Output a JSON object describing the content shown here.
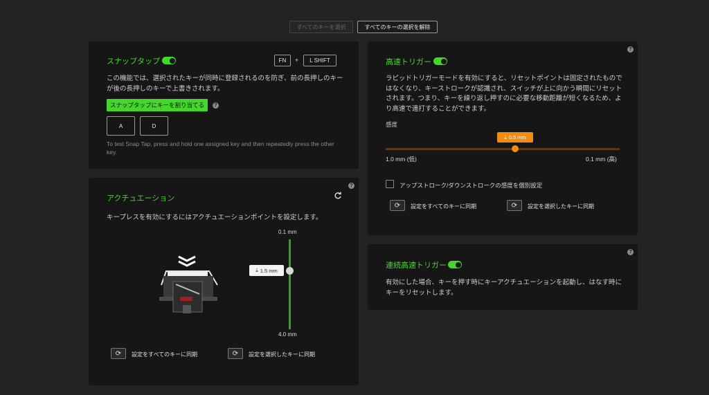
{
  "top": {
    "select_all": "すべてのキーを選択",
    "deselect_all": "すべてのキーの選択を解除"
  },
  "snap_tap": {
    "title": "スナップタップ",
    "key_fn": "FN",
    "plus": "+",
    "key_shift": "L SHIFT",
    "description": "この機能では、選択されたキーが同時に登録されるのを防ぎ、前の長押しのキーが後の長押しのキーで上書きされます。",
    "assign_button": "スナップタップにキーを割り当てる",
    "key_a": "A",
    "key_d": "D",
    "hint": "To test Snap Tap, press and hold one assigned key and then repeatedly press the other key."
  },
  "actuation": {
    "title": "アクチュエーション",
    "description": "キープレスを有効にするにはアクチュエーションポイントを設定します。",
    "top_label": "0.1 mm",
    "bottom_label": "4.0 mm",
    "value_label": "1.5 mm",
    "value": 1.5,
    "sync_all": "設定をすべてのキーに同期",
    "sync_selected": "設定を選択したキーに同期"
  },
  "rapid_trigger": {
    "title": "高速トリガー",
    "description": "ラピッドトリガーモードを有効にすると、リセットポイントは固定されたものではなくなり、キーストロークが認識され、スイッチが上に向かう瞬間にリセットされます。つまり、キーを繰り返し押すのに必要な移動距離が短くなるため、より高速で連打することができます。",
    "sensitivity_label": "感度",
    "value_label": "0.5 mm",
    "value": 0.5,
    "min_label": "1.0 mm (低)",
    "max_label": "0.1 mm (高)",
    "separate_label": "アップストローク/ダウンストロークの感度を個別設定",
    "sync_all": "設定をすべてのキーに同期",
    "sync_selected": "設定を選択したキーに同期"
  },
  "continuous_rapid": {
    "title": "連続高速トリガー",
    "description": "有効にした場合、キーを押す時にキーアクチュエーションを起動し、はなす時にキーをリセットします。"
  },
  "help_glyph": "?",
  "colors": {
    "accent": "#44d62c",
    "orange": "#f28c10",
    "panel": "#161616",
    "background": "#232323"
  }
}
